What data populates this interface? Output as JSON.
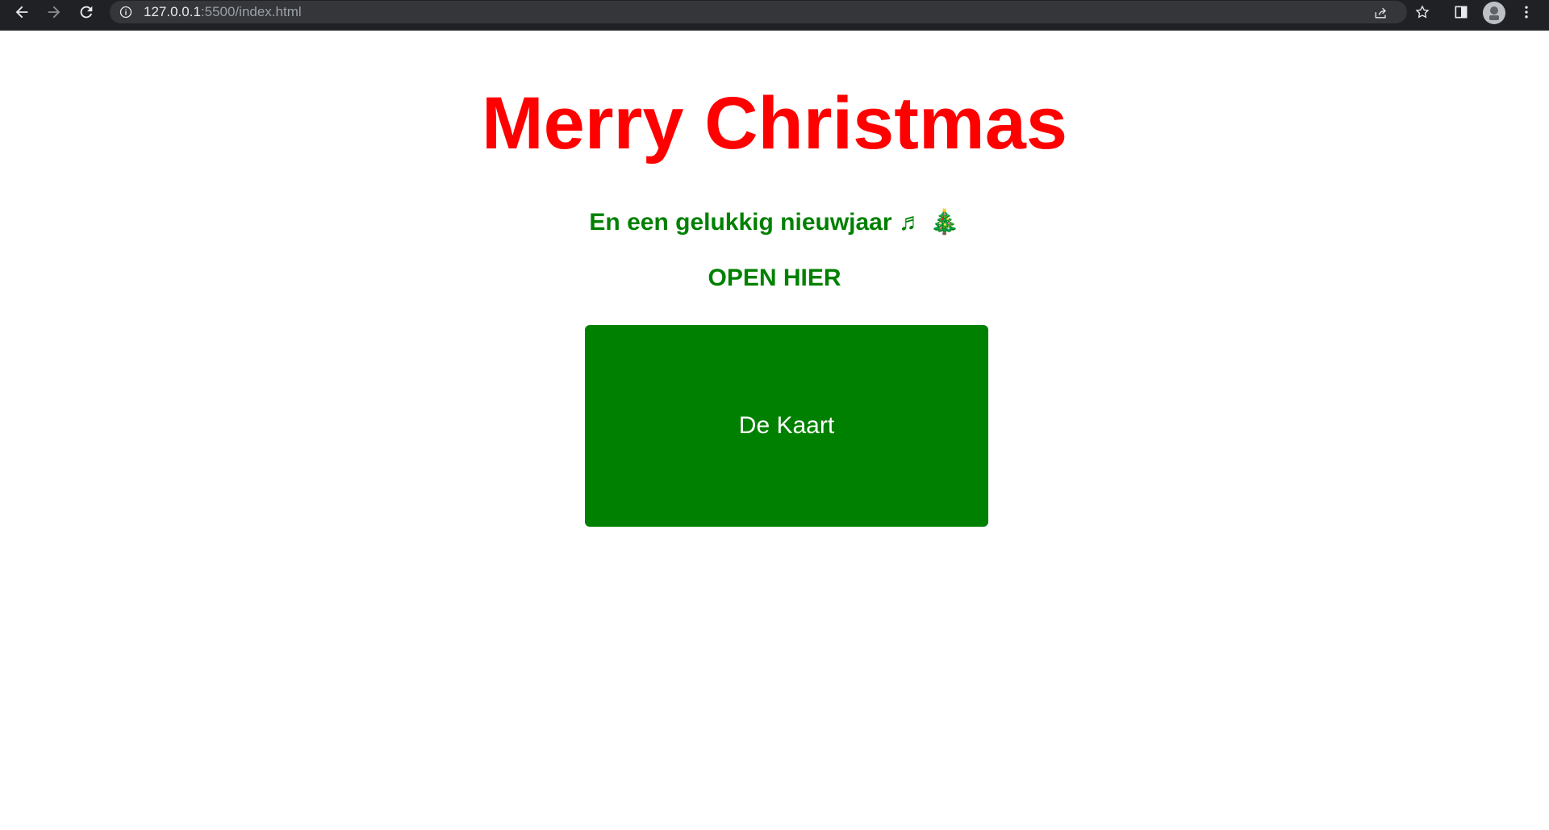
{
  "browser": {
    "url_host": "127.0.0.1",
    "url_rest": ":5500/index.html",
    "back_icon": "arrow-left-icon",
    "forward_icon": "arrow-right-icon",
    "reload_icon": "reload-icon",
    "share_icon": "share-icon",
    "bookmark_icon": "star-icon",
    "side_panel_icon": "side-panel-icon",
    "profile_icon": "avatar-icon",
    "menu_icon": "kebab-menu-icon"
  },
  "page": {
    "title": "Merry Christmas",
    "subtitle": "En een gelukkig nieuwjaar ♬ 🎄",
    "open_label": "OPEN HIER",
    "card_button_label": "De Kaart"
  },
  "colors": {
    "title": "#ff0000",
    "green": "#008000",
    "toolbar": "#202124"
  }
}
